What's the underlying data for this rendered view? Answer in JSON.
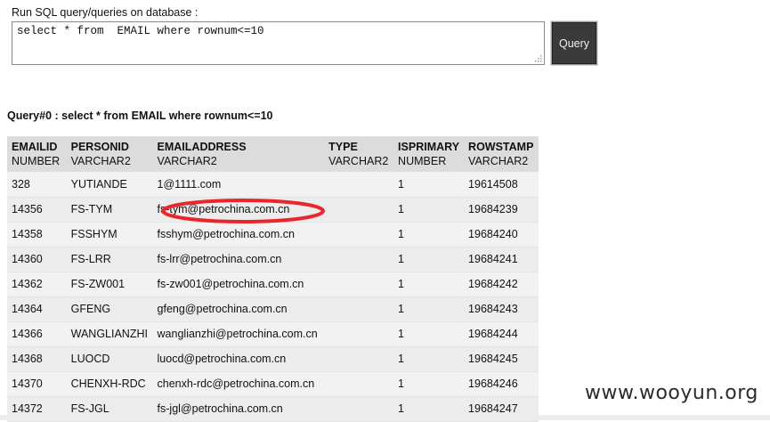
{
  "form": {
    "label": "Run SQL query/queries on database :",
    "sql_value": "select * from  EMAIL where rownum<=10",
    "query_button": "Query"
  },
  "result": {
    "title": "Query#0 : select * from EMAIL where rownum<=10",
    "columns": [
      {
        "name": "EMAILID",
        "type": "NUMBER"
      },
      {
        "name": "PERSONID",
        "type": "VARCHAR2"
      },
      {
        "name": "EMAILADDRESS",
        "type": "VARCHAR2"
      },
      {
        "name": "TYPE",
        "type": "VARCHAR2"
      },
      {
        "name": "ISPRIMARY",
        "type": "NUMBER"
      },
      {
        "name": "ROWSTAMP",
        "type": "VARCHAR2"
      }
    ],
    "rows": [
      [
        "328",
        "YUTIANDE",
        "1@1111.com",
        "",
        "1",
        "19614508"
      ],
      [
        "14356",
        "FS-TYM",
        "fs-tym@petrochina.com.cn",
        "",
        "1",
        "19684239"
      ],
      [
        "14358",
        "FSSHYM",
        "fsshym@petrochina.com.cn",
        "",
        "1",
        "19684240"
      ],
      [
        "14360",
        "FS-LRR",
        "fs-lrr@petrochina.com.cn",
        "",
        "1",
        "19684241"
      ],
      [
        "14362",
        "FS-ZW001",
        "fs-zw001@petrochina.com.cn",
        "",
        "1",
        "19684242"
      ],
      [
        "14364",
        "GFENG",
        "gfeng@petrochina.com.cn",
        "",
        "1",
        "19684243"
      ],
      [
        "14366",
        "WANGLIANZHI",
        "wanglianzhi@petrochina.com.cn",
        "",
        "1",
        "19684244"
      ],
      [
        "14368",
        "LUOCD",
        "luocd@petrochina.com.cn",
        "",
        "1",
        "19684245"
      ],
      [
        "14370",
        "CHENXH-RDC",
        "chenxh-rdc@petrochina.com.cn",
        "",
        "1",
        "19684246"
      ],
      [
        "14372",
        "FS-JGL",
        "fs-jgl@petrochina.com.cn",
        "",
        "1",
        "19684247"
      ]
    ]
  },
  "watermark": "www.wooyun.org",
  "colors": {
    "header_bg": "#dcdcdc",
    "row_bg": "#f2f2f2",
    "button_bg": "#3a3a3a",
    "annotation": "#e8262c"
  }
}
